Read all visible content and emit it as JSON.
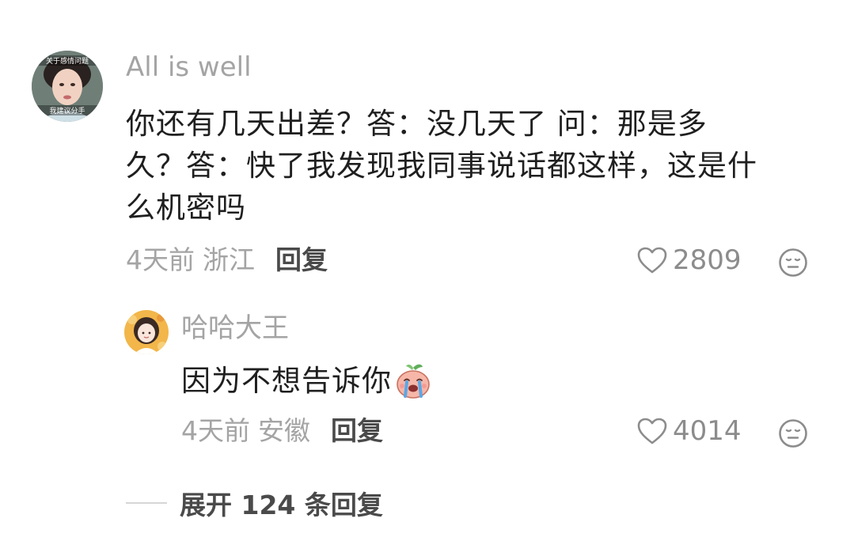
{
  "comment": {
    "username": "All is well",
    "avatar_icon": "drama-character-avatar",
    "avatar_caption_top": "关于感情问题",
    "avatar_caption_bottom": "我建议分手",
    "text_lines": [
      "你还有几天出差？答：没几天了 问：那是多",
      "久？答：快了我发现我同事说话都这样，这是什",
      "么机密吗"
    ],
    "time": "4天前",
    "location": "浙江",
    "reply_label": "回复",
    "likes": "2809",
    "like_icon": "heart-outline-icon",
    "dislike_icon": "meh-face-icon"
  },
  "reply": {
    "username": "哈哈大王",
    "avatar_icon": "cartoon-girl-avatar",
    "text": "因为不想告诉你",
    "emoji_icon": "crying-peach-emoji",
    "time": "4天前",
    "location": "安徽",
    "reply_label": "回复",
    "likes": "4014",
    "like_icon": "heart-outline-icon",
    "dislike_icon": "meh-face-icon"
  },
  "expand": {
    "label": "展开 124 条回复"
  },
  "colors": {
    "muted_text": "#a4a4a4",
    "body_text": "#1f1f1f",
    "action_text": "#4a4a4a",
    "icon_gray": "#8c8c8c"
  }
}
